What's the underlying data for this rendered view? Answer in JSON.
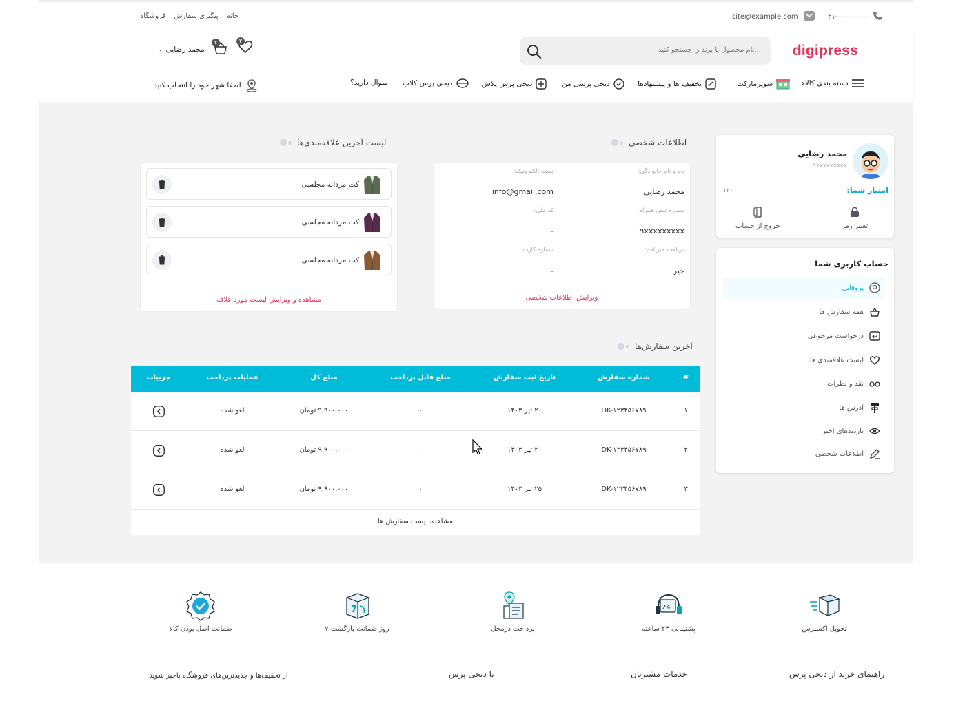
{
  "topbar": {
    "phone": "۰۲۱-۰۰۰۰۰۰۰۰",
    "email": "site@example.com",
    "links": [
      "خانه",
      "پیگیری سفارش",
      "فروشگاه"
    ]
  },
  "header": {
    "logo": "digipress",
    "search_placeholder": "نام محصول یا برند را جستجو کنید...",
    "user_name": "محمد رضایی",
    "cart_count": "۲",
    "wishlist_count": "۳"
  },
  "nav": {
    "items": [
      "دسته بندی کالاها",
      "سوپرمارکت",
      "تخفیف ها و پیشنهادها",
      "دیجی پرسی من",
      "دیجی پرس پلاس",
      "دیجی پرس کلاب",
      "سوال دارید؟"
    ],
    "city": "لطفا شهر خود را انتخاب کنید"
  },
  "profile_card": {
    "name": "محمد رضایی",
    "phone": "۰۹xxxxxxxxx",
    "score_label": "امتیاز شما:",
    "score_value": "۱۲۰",
    "change_password": "تغییر رمز",
    "logout": "خروج از حساب"
  },
  "account_menu": {
    "title": "حساب کاربری شما",
    "items": [
      "پروفایل",
      "همه سفارش ها",
      "درخواست مرجوعی",
      "لیست علاقمندی ها",
      "نقد و نظرات",
      "آدرس ها",
      "بازدیدهای اخیر",
      "اطلاعات شخصی"
    ]
  },
  "personal_info": {
    "title": "اطلاعات شخصی",
    "labels": {
      "name": "نام و نام خانوادگی:",
      "email": "پست الکترونیک:",
      "mobile": "شماره تلفن همراه:",
      "national_id": "کد ملی:",
      "newsletter": "دریافت خبرنامه:",
      "card": "شماره کارت:"
    },
    "values": {
      "name": "محمد رضایی",
      "email": "info@gmail.com",
      "mobile": "۰۹xxxxxxxxx",
      "national_id": "-",
      "newsletter": "خیر",
      "card": "-"
    },
    "edit_link": "ویرایش اطلاعات شخصی"
  },
  "wishlist": {
    "title": "لیست آخرین علاقه‌مندی‌ها",
    "items": [
      "کت مردانه مجلسی",
      "کت مردانه مجلسی",
      "کت مردانه مجلسی"
    ],
    "colors": [
      "#5b6b4e",
      "#5a2a4d",
      "#8a5a35"
    ],
    "view_link": "مشاهده و ویرایش لیست مورد علاقه"
  },
  "orders": {
    "title": "آخرین سفارش‌ها",
    "headers": [
      "#",
      "شماره سفارش",
      "تاریخ ثبت سفارش",
      "مبلغ قابل پرداخت",
      "مبلغ کل",
      "عملیات پرداخت",
      "جزییات"
    ],
    "rows": [
      {
        "idx": "۱",
        "order_no": "DK-۱۲۳۴۵۶۷۸۹",
        "date": "۲۰ تیر ۱۴۰۳",
        "payable": "۰",
        "total": "۹,۹۰۰,۰۰۰ تومان",
        "status": "لغو شده"
      },
      {
        "idx": "۲",
        "order_no": "DK-۱۲۳۴۵۶۷۸۹",
        "date": "۲۰ تیر ۱۴۰۳",
        "payable": "۰",
        "total": "۹,۹۰۰,۰۰۰ تومان",
        "status": "لغو شده"
      },
      {
        "idx": "۳",
        "order_no": "DK-۱۲۳۴۵۶۷۸۹",
        "date": "۲۵ تیر ۱۴۰۳",
        "payable": "۰",
        "total": "۹,۹۰۰,۰۰۰ تومان",
        "status": "لغو شده"
      }
    ],
    "view_all": "مشاهده لیست سفارش ها"
  },
  "features": [
    "تحویل اکسپرس",
    "پشتیبانی ۲۴ ساعته",
    "پرداخت درمحل",
    "۷ روز ضمانت بازگشت",
    "ضمانت اصل بودن کالا"
  ],
  "footer": {
    "col1": "راهنمای خرید از دیجی پرس",
    "col2": "خدمات مشتریان",
    "col3": "با دیجی پرس",
    "newsletter": "از تخفیف‌ها و جدیدترین‌های فروشگاه باخبر شوید:"
  },
  "colors": {
    "accent": "#00bcd9",
    "brand": "#e0325a"
  }
}
